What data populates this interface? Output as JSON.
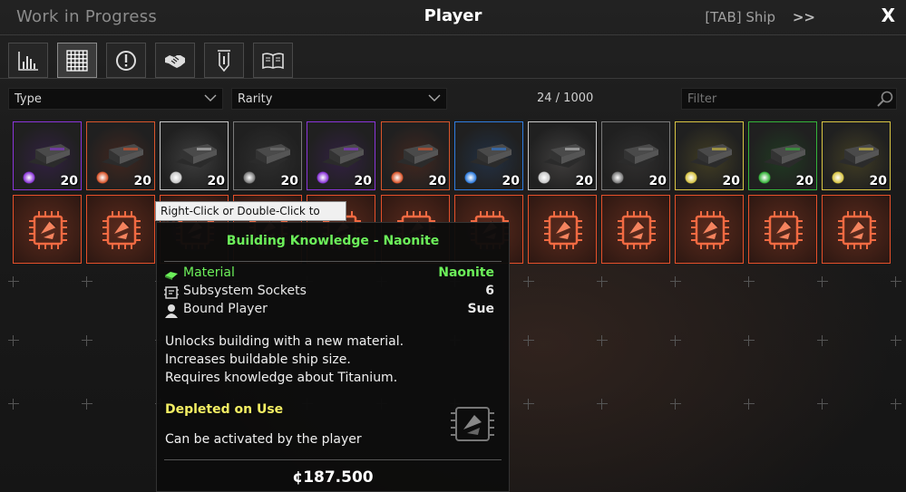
{
  "header": {
    "section_title": "Work in Progress",
    "title": "Player",
    "next_tab_label": "[TAB] Ship",
    "next_tab_arrows": ">>",
    "close_label": "X"
  },
  "tabs": [
    {
      "icon": "bar-chart-icon",
      "active": false
    },
    {
      "icon": "grid-icon",
      "active": true
    },
    {
      "icon": "alert-circle-icon",
      "active": false
    },
    {
      "icon": "handshake-icon",
      "active": false
    },
    {
      "icon": "shield-banner-icon",
      "active": false
    },
    {
      "icon": "book-icon",
      "active": false
    }
  ],
  "filters": {
    "type_label": "Type",
    "rarity_label": "Rarity",
    "count": "24 / 1000",
    "search_placeholder": "Filter"
  },
  "colors": {
    "purple": "#8a35d8",
    "orange": "#d9552b",
    "white": "#c8c8c8",
    "grey": "#7a7a7a",
    "blue": "#2f7de0",
    "yellow": "#d8c443",
    "green": "#35b33a",
    "knowledge": "#e5502a",
    "tooltip_title": "#6cf05a",
    "depleted": "#f3ee63"
  },
  "turret_row": [
    {
      "rarity": "purple",
      "count": "20"
    },
    {
      "rarity": "orange",
      "count": "20"
    },
    {
      "rarity": "white",
      "count": "20"
    },
    {
      "rarity": "grey",
      "count": "20"
    },
    {
      "rarity": "purple",
      "count": "20"
    },
    {
      "rarity": "orange",
      "count": "20"
    },
    {
      "rarity": "blue",
      "count": "20"
    },
    {
      "rarity": "white",
      "count": "20"
    },
    {
      "rarity": "grey",
      "count": "20"
    },
    {
      "rarity": "yellow",
      "count": "20"
    },
    {
      "rarity": "green",
      "count": "20"
    },
    {
      "rarity": "yellow",
      "count": "20"
    }
  ],
  "knowledge_row_count": 12,
  "hint": "Right-Click or Double-Click to use",
  "tooltip": {
    "title": "Building Knowledge - Naonite",
    "rows": [
      {
        "icon": "material-icon",
        "label": "Material",
        "value": "Naonite"
      },
      {
        "icon": "socket-icon",
        "label": "Subsystem Sockets",
        "value": "6"
      },
      {
        "icon": "player-icon",
        "label": "Bound Player",
        "value": "Sue"
      }
    ],
    "description": [
      "Unlocks building with a new material.",
      "Increases buildable ship size.",
      "Requires knowledge about Titanium."
    ],
    "depleted": "Depleted on Use",
    "activation": "Can be activated by the player",
    "price": "¢187.500"
  }
}
